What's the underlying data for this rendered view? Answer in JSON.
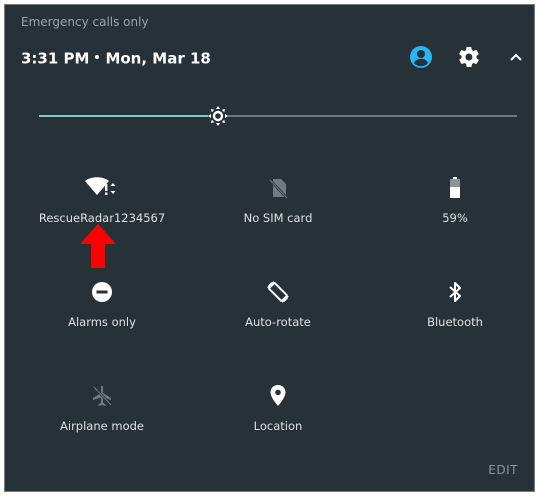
{
  "status": {
    "text": "Emergency calls only"
  },
  "header": {
    "time": "3:31 PM",
    "date": "Mon, Mar 18"
  },
  "brightness": {
    "level": 0.375
  },
  "tiles": [
    {
      "label": "RescueRadar1234567",
      "icon": "wifi-icon"
    },
    {
      "label": "No SIM card",
      "icon": "no-sim-icon"
    },
    {
      "label": "59%",
      "icon": "battery-icon"
    },
    {
      "label": "Alarms only",
      "icon": "do-not-disturb-icon"
    },
    {
      "label": "Auto-rotate",
      "icon": "auto-rotate-icon"
    },
    {
      "label": "Bluetooth",
      "icon": "bluetooth-icon"
    },
    {
      "label": "Airplane mode",
      "icon": "airplane-icon"
    },
    {
      "label": "Location",
      "icon": "location-icon"
    }
  ],
  "footer": {
    "edit_label": "EDIT"
  },
  "colors": {
    "panel_bg": "#263238",
    "accent": "#80cbc4",
    "avatar": "#29b6f6",
    "annotation_arrow": "#ff0000"
  }
}
